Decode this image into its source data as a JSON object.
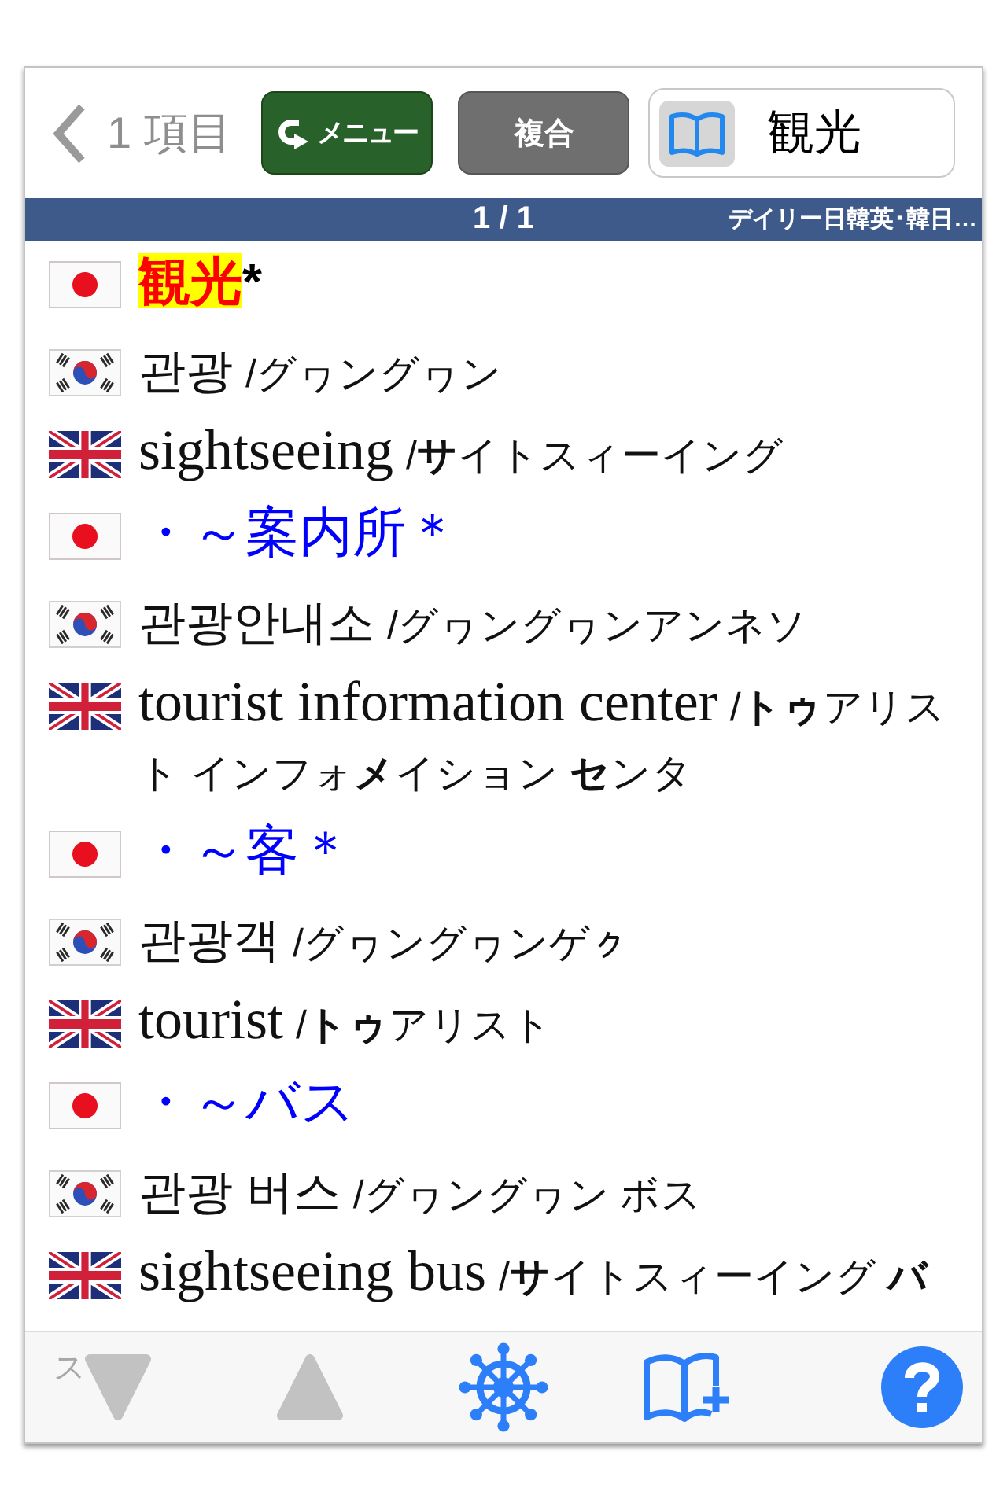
{
  "header": {
    "back_button": {
      "label": "1 項目"
    },
    "menu_button": {
      "label": "メニュー"
    },
    "mode_button": {
      "label": "複合"
    },
    "search": {
      "value": "観光"
    }
  },
  "status_bar": {
    "page": "1 / 1",
    "dictionary": "デイリー日韓英･韓日…"
  },
  "entries": [
    {
      "kind": "ja",
      "word": "観光",
      "mark": "*",
      "highlighted": true
    },
    {
      "kind": "ko",
      "word": "관광",
      "reading": "/グヮングヮン"
    },
    {
      "kind": "en",
      "word": "sightseeing",
      "reading": "/**サ**イトスィーイング"
    },
    {
      "kind": "ja",
      "word": "・～案内所＊",
      "highlighted": false
    },
    {
      "kind": "ko",
      "word": "관광안내소",
      "reading": "/グヮングヮンアンネソ"
    },
    {
      "kind": "en",
      "word": "tourist information center",
      "reading": "/**トゥ**アリスト インフォ**メ**イション **セ**ンタ"
    },
    {
      "kind": "ja",
      "word": "・～客＊",
      "highlighted": false
    },
    {
      "kind": "ko",
      "word": "관광객",
      "reading": "/グヮングヮンゲㇰ"
    },
    {
      "kind": "en",
      "word": "tourist",
      "reading": "/**トゥ**アリスト"
    },
    {
      "kind": "ja",
      "word": "・～バス",
      "highlighted": false
    },
    {
      "kind": "ko",
      "word": "관광 버스",
      "reading": "/グヮングヮン ボス"
    },
    {
      "kind": "en",
      "word": "sightseeing bus",
      "reading": "/**サ**イトスィーイング **バ**"
    }
  ],
  "toolbar": [
    {
      "kind": "down",
      "label": "ス",
      "disabled": true
    },
    {
      "kind": "up",
      "disabled": true
    },
    {
      "kind": "wheel",
      "disabled": false
    },
    {
      "kind": "add_bookmark",
      "disabled": false
    },
    {
      "kind": "help",
      "disabled": false
    }
  ]
}
